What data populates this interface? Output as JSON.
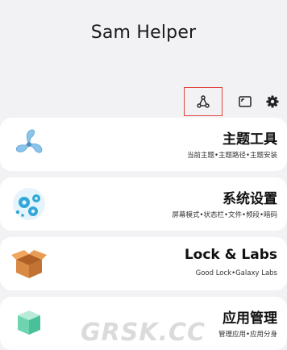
{
  "app": {
    "title": "Sam Helper"
  },
  "toolbar": {
    "icons": [
      "share-nodes-icon",
      "window-icon",
      "gear-icon"
    ],
    "highlight_color": "#e0463f"
  },
  "cards": [
    {
      "title": "主题工具",
      "subtitle": "当前主题•主题路径•主题安装",
      "icon": "fan-icon"
    },
    {
      "title": "系统设置",
      "subtitle": "屏幕模式•状态栏•文件•频段•暗码",
      "icon": "gears-icon"
    },
    {
      "title": "Lock & Labs",
      "subtitle": "Good Lock•Galaxy Labs",
      "icon": "box-icon"
    },
    {
      "title": "应用管理",
      "subtitle": "管理应用•应用分身",
      "icon": "cube-icon"
    }
  ],
  "watermark": "GRSK.CC"
}
